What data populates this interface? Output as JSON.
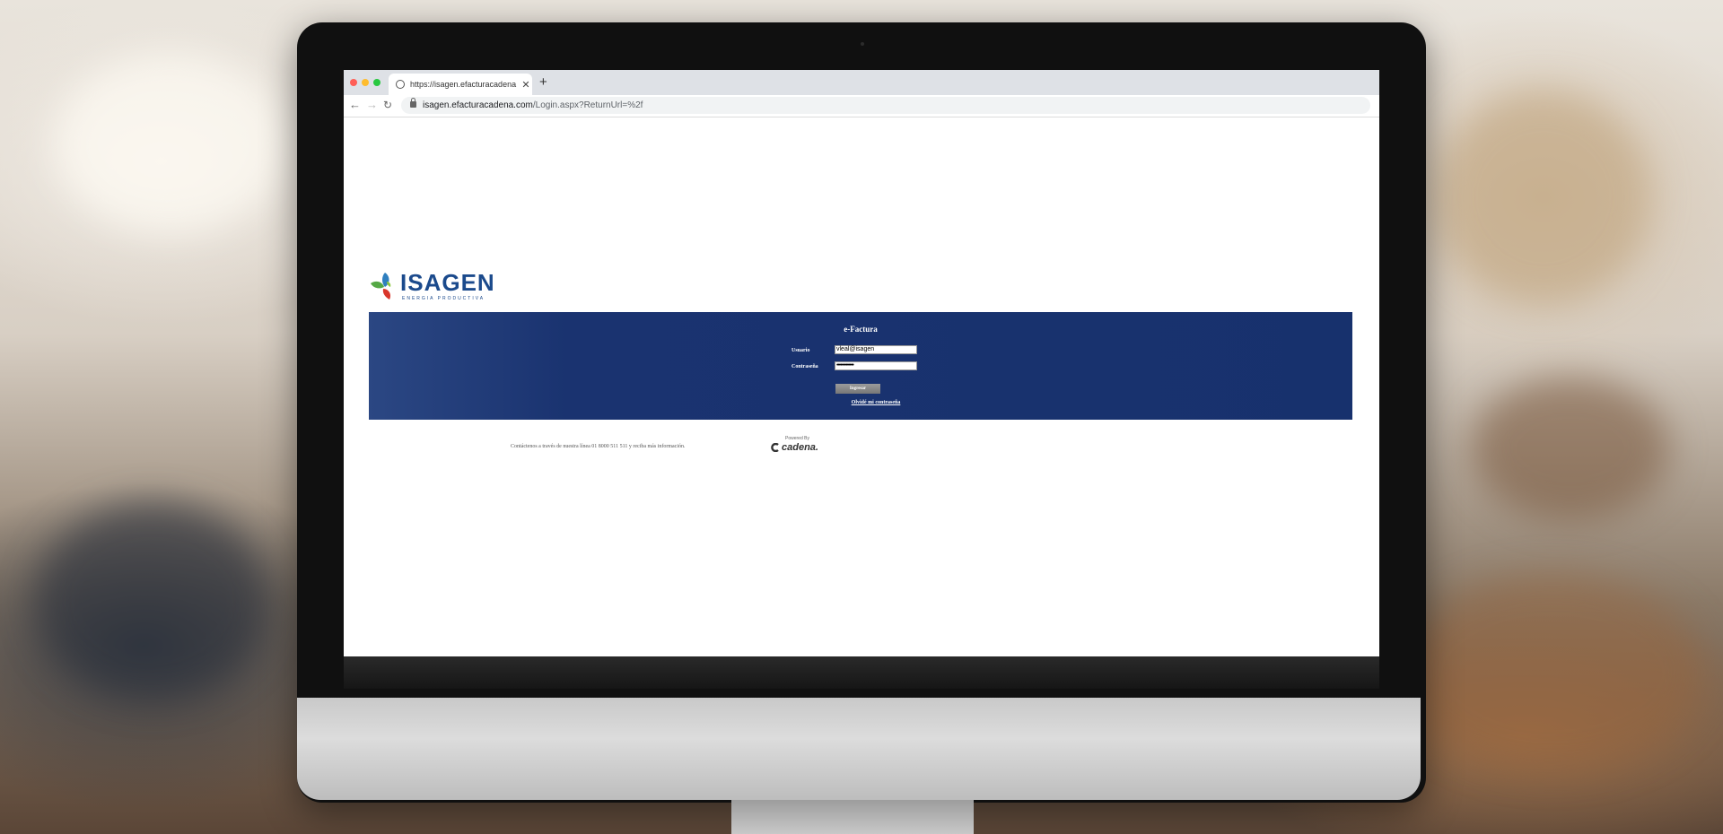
{
  "browser": {
    "tab_title": "https://isagen.efacturacadena",
    "new_tab": "+",
    "url_host": "isagen.efacturacadena.com",
    "url_path": "/Login.aspx?ReturnUrl=%2f"
  },
  "logo": {
    "name": "ISAGEN",
    "tagline": "ENERGIA PRODUCTIVA"
  },
  "login": {
    "title": "e-Factura",
    "user_label": "Usuario",
    "user_value": "vleal@isagen",
    "pass_label": "Contraseña",
    "pass_value": "•••••••••••••",
    "submit_label": "Ingresar",
    "forgot_label": "Olvidé mi contraseña"
  },
  "footer": {
    "contact": "Contáctenos a través de nuestra línea 01 8000 511 511 y reciba más información.",
    "powered_by": "Powered By",
    "brand": "cadena."
  },
  "colors": {
    "band": "#17316d",
    "logo_blue": "#1b4a8c"
  }
}
